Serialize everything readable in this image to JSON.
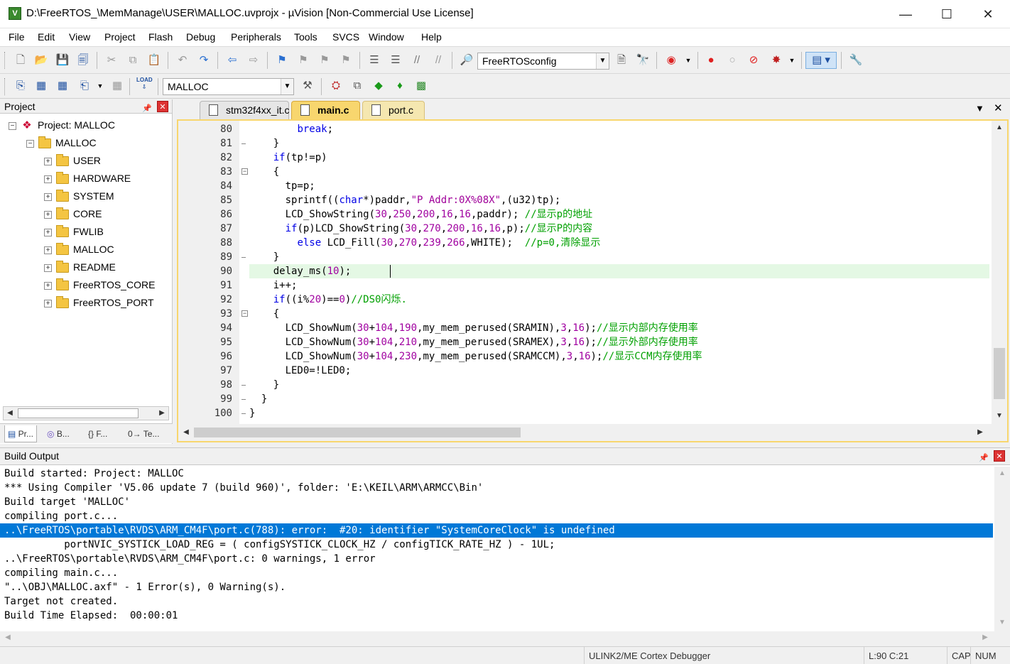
{
  "window": {
    "title": "D:\\FreeRTOS_\\MemManage\\USER\\MALLOC.uvprojx - µVision  [Non-Commercial Use License]",
    "app_icon_letter": "V",
    "minimize": "—",
    "maximize": "☐",
    "close": "✕"
  },
  "menu": [
    "File",
    "Edit",
    "View",
    "Project",
    "Flash",
    "Debug",
    "Peripherals",
    "Tools",
    "SVCS",
    "Window",
    "Help"
  ],
  "toolbar1": {
    "config_combo": "FreeRTOSconfig"
  },
  "toolbar2": {
    "target_combo": "MALLOC",
    "load_label": "LOAD"
  },
  "project_panel": {
    "title": "Project",
    "root": "Project: MALLOC",
    "target": "MALLOC",
    "groups": [
      "USER",
      "HARDWARE",
      "SYSTEM",
      "CORE",
      "FWLIB",
      "MALLOC",
      "README",
      "FreeRTOS_CORE",
      "FreeRTOS_PORT"
    ],
    "tabs": [
      "Pr...",
      "B...",
      "{} F...",
      "0→ Te..."
    ]
  },
  "editor": {
    "tabs": [
      {
        "label": "stm32f4xx_it.c",
        "state": "inactive"
      },
      {
        "label": "main.c",
        "state": "active"
      },
      {
        "label": "port.c",
        "state": "modified"
      }
    ],
    "highlight_line": 90,
    "lines": [
      {
        "n": "80",
        "seg": [
          [
            "plain",
            "        "
          ],
          [
            "kw",
            "break"
          ],
          [
            "plain",
            ";"
          ]
        ]
      },
      {
        "n": "81",
        "seg": [
          [
            "plain",
            "    }"
          ]
        ]
      },
      {
        "n": "82",
        "seg": [
          [
            "plain",
            "    "
          ],
          [
            "kw",
            "if"
          ],
          [
            "plain",
            "(tp!=p)"
          ]
        ]
      },
      {
        "n": "83",
        "seg": [
          [
            "plain",
            "    {"
          ]
        ]
      },
      {
        "n": "84",
        "seg": [
          [
            "plain",
            "      tp=p;"
          ]
        ]
      },
      {
        "n": "85",
        "seg": [
          [
            "plain",
            "      sprintf(("
          ],
          [
            "kw",
            "char"
          ],
          [
            "plain",
            "*)paddr,"
          ],
          [
            "str",
            "\"P Addr:0X%08X\""
          ],
          [
            "plain",
            ",(u32)tp);"
          ]
        ]
      },
      {
        "n": "86",
        "seg": [
          [
            "plain",
            "      LCD_ShowString("
          ],
          [
            "num",
            "30"
          ],
          [
            "plain",
            ","
          ],
          [
            "num",
            "250"
          ],
          [
            "plain",
            ","
          ],
          [
            "num",
            "200"
          ],
          [
            "plain",
            ","
          ],
          [
            "num",
            "16"
          ],
          [
            "plain",
            ","
          ],
          [
            "num",
            "16"
          ],
          [
            "plain",
            ",paddr); "
          ],
          [
            "cmt",
            "//显示p的地址"
          ]
        ]
      },
      {
        "n": "87",
        "seg": [
          [
            "plain",
            "      "
          ],
          [
            "kw",
            "if"
          ],
          [
            "plain",
            "(p)LCD_ShowString("
          ],
          [
            "num",
            "30"
          ],
          [
            "plain",
            ","
          ],
          [
            "num",
            "270"
          ],
          [
            "plain",
            ","
          ],
          [
            "num",
            "200"
          ],
          [
            "plain",
            ","
          ],
          [
            "num",
            "16"
          ],
          [
            "plain",
            ","
          ],
          [
            "num",
            "16"
          ],
          [
            "plain",
            ",p);"
          ],
          [
            "cmt",
            "//显示P的内容"
          ]
        ]
      },
      {
        "n": "88",
        "seg": [
          [
            "plain",
            "        "
          ],
          [
            "kw",
            "else"
          ],
          [
            "plain",
            " LCD_Fill("
          ],
          [
            "num",
            "30"
          ],
          [
            "plain",
            ","
          ],
          [
            "num",
            "270"
          ],
          [
            "plain",
            ","
          ],
          [
            "num",
            "239"
          ],
          [
            "plain",
            ","
          ],
          [
            "num",
            "266"
          ],
          [
            "plain",
            ",WHITE);  "
          ],
          [
            "cmt",
            "//p=0,清除显示"
          ]
        ]
      },
      {
        "n": "89",
        "seg": [
          [
            "plain",
            "    }"
          ]
        ]
      },
      {
        "n": "90",
        "seg": [
          [
            "plain",
            "    delay_ms("
          ],
          [
            "num",
            "10"
          ],
          [
            "plain",
            ");  "
          ]
        ]
      },
      {
        "n": "91",
        "seg": [
          [
            "plain",
            "    i++;"
          ]
        ]
      },
      {
        "n": "92",
        "seg": [
          [
            "plain",
            "    "
          ],
          [
            "kw",
            "if"
          ],
          [
            "plain",
            "((i%"
          ],
          [
            "num",
            "20"
          ],
          [
            "plain",
            ")=="
          ],
          [
            "num",
            "0"
          ],
          [
            "plain",
            ")"
          ],
          [
            "cmt",
            "//DS0闪烁."
          ]
        ]
      },
      {
        "n": "93",
        "seg": [
          [
            "plain",
            "    {"
          ]
        ]
      },
      {
        "n": "94",
        "seg": [
          [
            "plain",
            "      LCD_ShowNum("
          ],
          [
            "num",
            "30"
          ],
          [
            "plain",
            "+"
          ],
          [
            "num",
            "104"
          ],
          [
            "plain",
            ","
          ],
          [
            "num",
            "190"
          ],
          [
            "plain",
            ",my_mem_perused(SRAMIN),"
          ],
          [
            "num",
            "3"
          ],
          [
            "plain",
            ","
          ],
          [
            "num",
            "16"
          ],
          [
            "plain",
            ");"
          ],
          [
            "cmt",
            "//显示内部内存使用率"
          ]
        ]
      },
      {
        "n": "95",
        "seg": [
          [
            "plain",
            "      LCD_ShowNum("
          ],
          [
            "num",
            "30"
          ],
          [
            "plain",
            "+"
          ],
          [
            "num",
            "104"
          ],
          [
            "plain",
            ","
          ],
          [
            "num",
            "210"
          ],
          [
            "plain",
            ",my_mem_perused(SRAMEX),"
          ],
          [
            "num",
            "3"
          ],
          [
            "plain",
            ","
          ],
          [
            "num",
            "16"
          ],
          [
            "plain",
            ");"
          ],
          [
            "cmt",
            "//显示外部内存使用率"
          ]
        ]
      },
      {
        "n": "96",
        "seg": [
          [
            "plain",
            "      LCD_ShowNum("
          ],
          [
            "num",
            "30"
          ],
          [
            "plain",
            "+"
          ],
          [
            "num",
            "104"
          ],
          [
            "plain",
            ","
          ],
          [
            "num",
            "230"
          ],
          [
            "plain",
            ",my_mem_perused(SRAMCCM),"
          ],
          [
            "num",
            "3"
          ],
          [
            "plain",
            ","
          ],
          [
            "num",
            "16"
          ],
          [
            "plain",
            ");"
          ],
          [
            "cmt",
            "//显示CCM内存使用率"
          ]
        ]
      },
      {
        "n": "97",
        "seg": [
          [
            "plain",
            "      LED0=!LED0;"
          ]
        ]
      },
      {
        "n": "98",
        "seg": [
          [
            "plain",
            "    }"
          ]
        ]
      },
      {
        "n": "99",
        "seg": [
          [
            "plain",
            "  }"
          ]
        ]
      },
      {
        "n": "100",
        "seg": [
          [
            "plain",
            "}"
          ]
        ]
      }
    ]
  },
  "build_output": {
    "title": "Build Output",
    "selected_index": 4,
    "lines": [
      "Build started: Project: MALLOC",
      "*** Using Compiler 'V5.06 update 7 (build 960)', folder: 'E:\\KEIL\\ARM\\ARMCC\\Bin'",
      "Build target 'MALLOC'",
      "compiling port.c...",
      "..\\FreeRTOS\\portable\\RVDS\\ARM_CM4F\\port.c(788): error:  #20: identifier \"SystemCoreClock\" is undefined",
      "          portNVIC_SYSTICK_LOAD_REG = ( configSYSTICK_CLOCK_HZ / configTICK_RATE_HZ ) - 1UL;",
      "..\\FreeRTOS\\portable\\RVDS\\ARM_CM4F\\port.c: 0 warnings, 1 error",
      "compiling main.c...",
      "\"..\\OBJ\\MALLOC.axf\" - 1 Error(s), 0 Warning(s).",
      "Target not created.",
      "Build Time Elapsed:  00:00:01"
    ]
  },
  "status_bar": {
    "debugger": "ULINK2/ME Cortex Debugger",
    "position": "L:90 C:21",
    "cap": "CAP",
    "num": "NUM"
  },
  "colors": {
    "active_tab": "#f8d66e",
    "selection": "#0078d7",
    "keyword": "#0000e6",
    "comment": "#00a000",
    "number": "#a000a0",
    "current_line": "#e4f8e4"
  }
}
